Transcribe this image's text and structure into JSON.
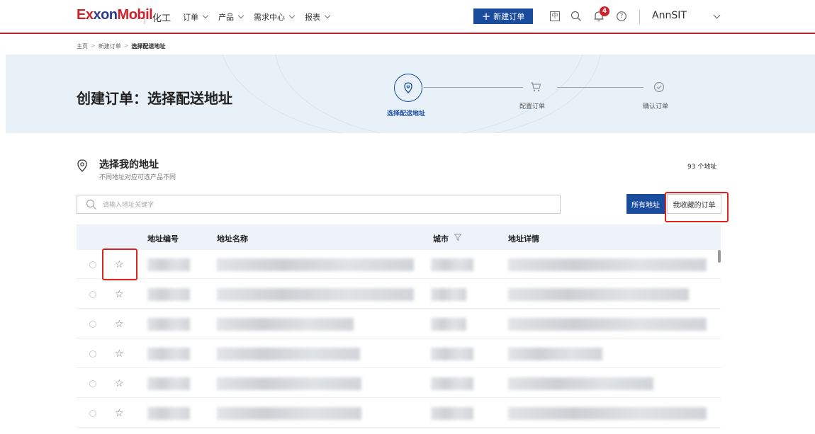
{
  "header": {
    "logo": {
      "part1": "Ex",
      "part2": "xon",
      "part3": "Mobil"
    },
    "division": "化工",
    "nav": [
      {
        "label": "订单"
      },
      {
        "label": "产品"
      },
      {
        "label": "需求中心"
      },
      {
        "label": "报表"
      }
    ],
    "new_order_plus": "+",
    "new_order_label": "新建订单",
    "lang_icon_text": "中",
    "notification_count": "4",
    "help_icon_text": "?",
    "user_name": "AnnSIT"
  },
  "breadcrumb": {
    "home": "主页",
    "parent": "新建订单",
    "current": "选择配送地址",
    "separator": ">"
  },
  "banner": {
    "title": "创建订单：选择配送地址",
    "steps": [
      {
        "label": "选择配送地址",
        "icon": "location-heart-icon",
        "active": true
      },
      {
        "label": "配置订单",
        "icon": "cart-icon",
        "active": false
      },
      {
        "label": "确认订单",
        "icon": "check-circle-icon",
        "active": false
      }
    ]
  },
  "address_section": {
    "title": "选择我的地址",
    "subtitle": "不同地址对应可选产品不同",
    "count": "93 个地址",
    "search_placeholder": "请输入地址关键字",
    "all_addresses_button": "所有地址",
    "favorite_orders_button": "我收藏的订单"
  },
  "table": {
    "columns": [
      "地址编号",
      "地址名称",
      "城市",
      "地址详情"
    ],
    "rows": [
      {
        "starred": false
      },
      {
        "starred": false
      },
      {
        "starred": false
      },
      {
        "starred": false
      },
      {
        "starred": false
      },
      {
        "starred": false
      }
    ]
  },
  "colors": {
    "brand_red": "#d0212b",
    "brand_blue": "#1a4c9e",
    "highlight_red": "#e0231c"
  }
}
